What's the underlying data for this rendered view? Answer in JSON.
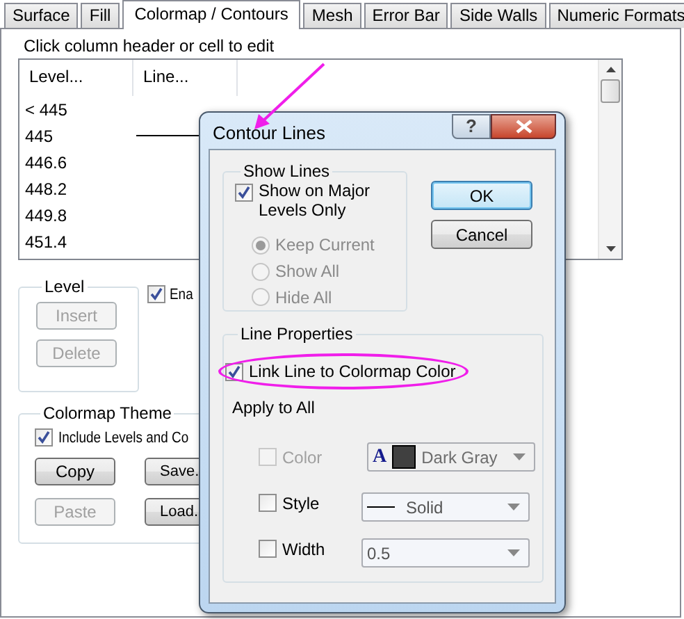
{
  "tabs": [
    {
      "label": "Surface",
      "selected": false
    },
    {
      "label": "Fill",
      "selected": false
    },
    {
      "label": "Colormap / Contours",
      "selected": true
    },
    {
      "label": "Mesh",
      "selected": false
    },
    {
      "label": "Error Bar",
      "selected": false
    },
    {
      "label": "Side Walls",
      "selected": false
    },
    {
      "label": "Numeric Formats",
      "selected": false
    }
  ],
  "hint": "Click column header or cell to edit",
  "level_table": {
    "columns": [
      "Level...",
      "Line..."
    ],
    "rows": [
      {
        "level": "< 445",
        "line": false
      },
      {
        "level": "445",
        "line": true
      },
      {
        "level": "446.6",
        "line": false
      },
      {
        "level": "448.2",
        "line": false
      },
      {
        "level": "449.8",
        "line": false
      },
      {
        "level": "451.4",
        "line": false
      }
    ]
  },
  "level_group": {
    "title": "Level",
    "buttons": [
      {
        "label": "Insert",
        "disabled": true
      },
      {
        "label": "Delete",
        "disabled": true
      }
    ]
  },
  "enable_checkbox": {
    "label": "Ena",
    "checked": true
  },
  "colormap_theme": {
    "title": "Colormap Theme",
    "include_checkbox": {
      "label": "Include Levels and Co",
      "checked": true
    },
    "buttons": [
      {
        "label": "Copy",
        "disabled": false
      },
      {
        "label": "Save.",
        "disabled": false
      },
      {
        "label": "Paste",
        "disabled": true
      },
      {
        "label": "Load.",
        "disabled": false
      }
    ]
  },
  "dialog": {
    "title": "Contour Lines",
    "help_label": "?",
    "show_lines": {
      "title": "Show Lines",
      "major_only": {
        "label": "Show on Major Levels Only",
        "checked": true
      },
      "options": [
        {
          "label": "Keep Current",
          "selected": true,
          "disabled": true
        },
        {
          "label": "Show All",
          "selected": false,
          "disabled": true
        },
        {
          "label": "Hide All",
          "selected": false,
          "disabled": true
        }
      ]
    },
    "buttons": [
      {
        "label": "OK",
        "default": true
      },
      {
        "label": "Cancel",
        "default": false
      }
    ],
    "line_properties": {
      "title": "Line Properties",
      "link_color": {
        "label": "Link Line to Colormap Color",
        "checked": true,
        "highlighted": true
      },
      "apply_label": "Apply to All",
      "rows": [
        {
          "label": "Color",
          "checked": false,
          "disabled": true,
          "combo": {
            "kind": "color",
            "glyph": "A",
            "color": "#404040",
            "value": "Dark Gray"
          }
        },
        {
          "label": "Style",
          "checked": false,
          "disabled": false,
          "combo": {
            "kind": "line",
            "value": "Solid"
          }
        },
        {
          "label": "Width",
          "checked": false,
          "disabled": false,
          "combo": {
            "kind": "text",
            "value": "0.5"
          }
        }
      ]
    }
  }
}
